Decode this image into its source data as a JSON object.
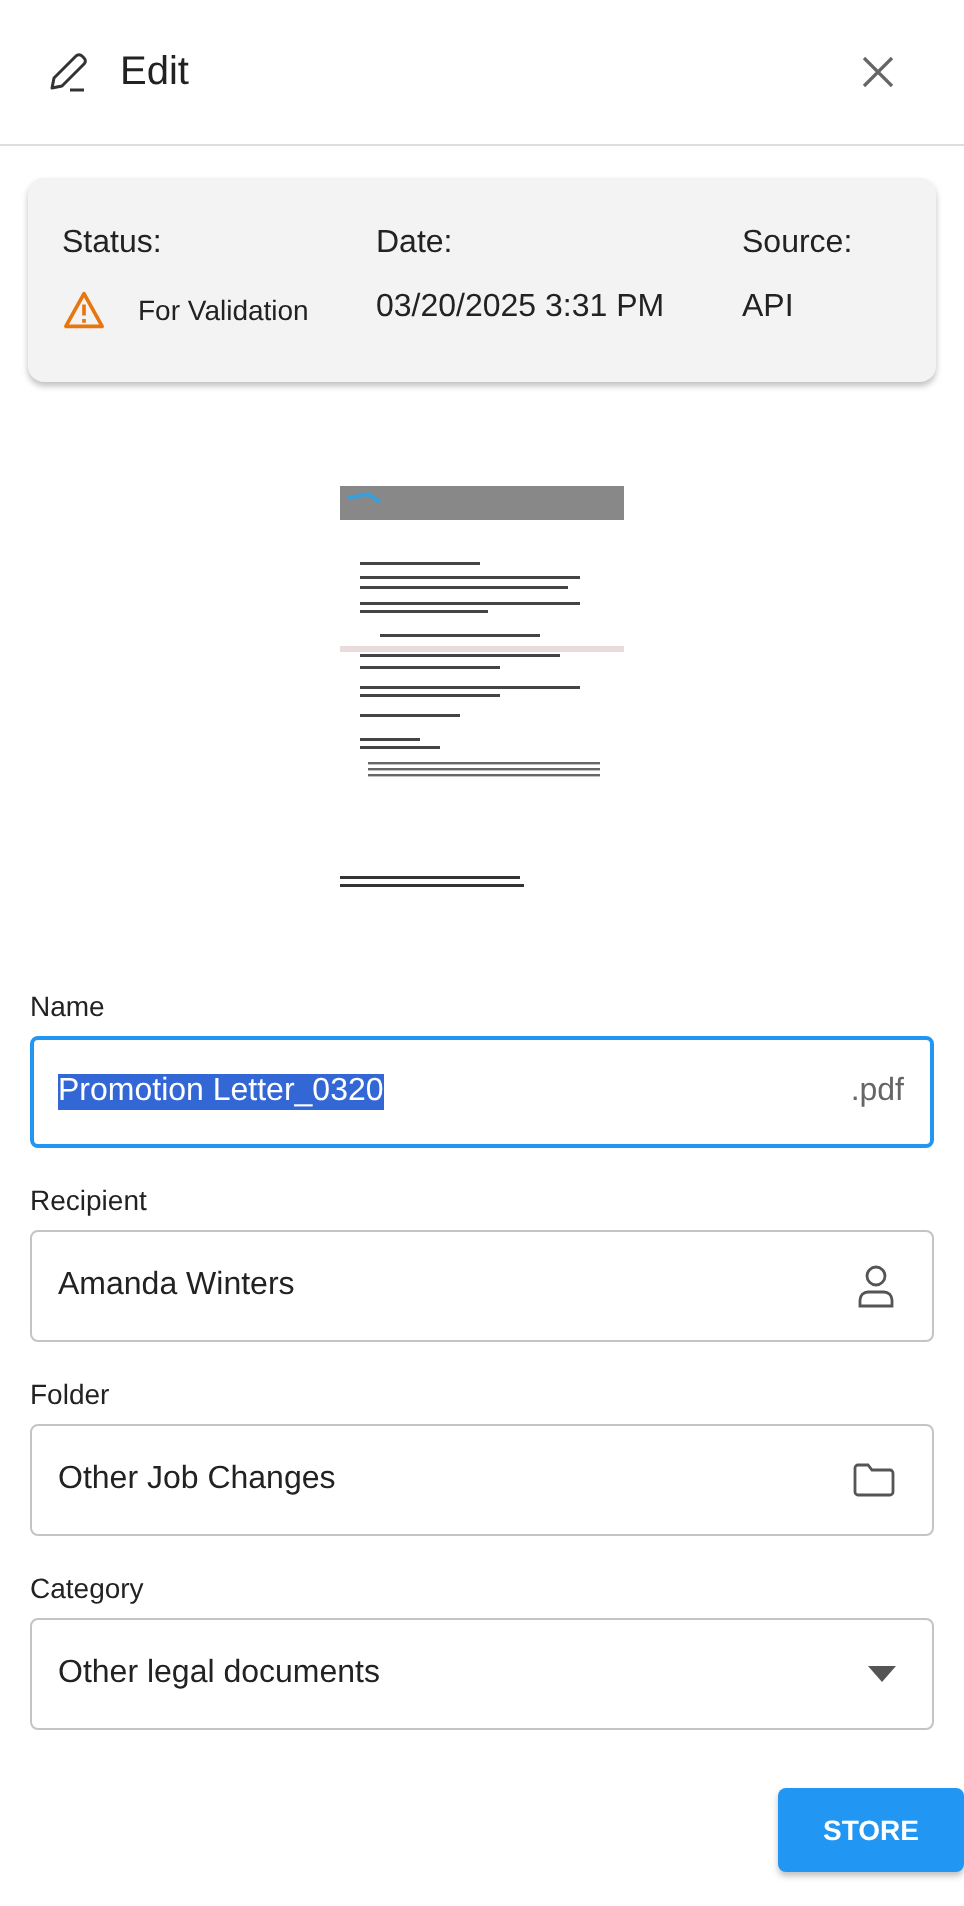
{
  "header": {
    "title": "Edit"
  },
  "info": {
    "status_label": "Status:",
    "status": "For Validation",
    "date_label": "Date:",
    "date": "03/20/2025 3:31 PM",
    "source_label": "Source:",
    "source": "API"
  },
  "fields": [
    {
      "kind": "text",
      "label": "Name",
      "value": "Promotion Letter_0320",
      "suffix": ".pdf",
      "focused": true
    },
    {
      "kind": "person",
      "label": "Recipient",
      "value": "Amanda Winters",
      "focused": false
    },
    {
      "kind": "folder",
      "label": "Folder",
      "value": "Other Job Changes",
      "focused": false
    },
    {
      "kind": "select",
      "label": "Category",
      "value": "Other legal documents",
      "focused": false
    }
  ],
  "store_button": "STORE"
}
